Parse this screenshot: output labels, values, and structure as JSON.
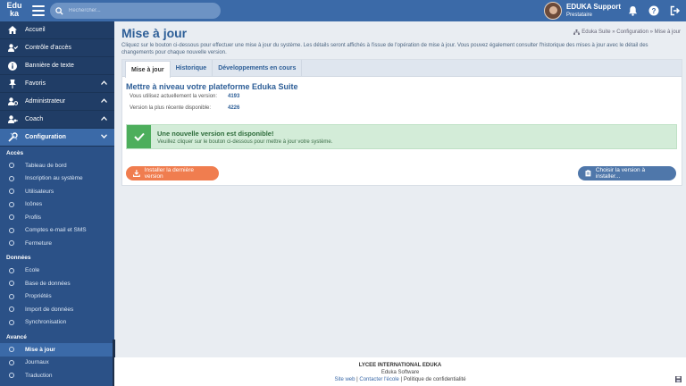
{
  "app": {
    "logo_top": "Edu",
    "logo_bottom": "ka"
  },
  "search": {
    "placeholder": "Rechercher..."
  },
  "user": {
    "name": "EDUKA Support",
    "role": "Prestataire"
  },
  "sidebar": {
    "items": [
      {
        "label": "Accueil",
        "icon": "home-icon"
      },
      {
        "label": "Contrôle d'accès",
        "icon": "user-check-icon"
      },
      {
        "label": "Bannière de texte",
        "icon": "info-icon"
      },
      {
        "label": "Favoris",
        "icon": "pin-icon"
      },
      {
        "label": "Administrateur",
        "icon": "user-gear-icon"
      },
      {
        "label": "Coach",
        "icon": "user-key-icon"
      },
      {
        "label": "Configuration",
        "icon": "tools-icon"
      }
    ],
    "sections": {
      "acces": {
        "title": "Accès",
        "items": [
          "Tableau de bord",
          "Inscription au système",
          "Utilisateurs",
          "Icônes",
          "Profils",
          "Comptes e-mail et SMS",
          "Fermeture"
        ]
      },
      "donnees": {
        "title": "Données",
        "items": [
          "Ecole",
          "Base de données",
          "Propriétés",
          "Import de données",
          "Synchronisation"
        ]
      },
      "avance": {
        "title": "Avancé",
        "items": [
          "Mise à jour",
          "Journaux",
          "Traduction"
        ]
      }
    }
  },
  "page": {
    "title": "Mise à jour",
    "breadcrumb": "Eduka Suite » Configuration » Mise à jour",
    "intro": "Cliquez sur le bouton ci-dessous pour effectuer une mise à jour du système. Les détails seront affichés à l'issue de l'opération de mise à jour. Vous pouvez également consulter l'historique des mises à jour avec le détail des changements pour chaque nouvelle version."
  },
  "tabs": [
    "Mise à jour",
    "Historique",
    "Développements en cours"
  ],
  "upgrade": {
    "title": "Mettre à niveau votre plateforme Eduka Suite",
    "current_label": "Vous utilisez actuellement la version:",
    "current_value": "4193",
    "latest_label": "Version la plus récente disponible:",
    "latest_value": "4226"
  },
  "alert": {
    "title": "Une nouvelle version est disponible!",
    "text": "Veuillez cliquer sur le bouton ci-dessous pour mettre à jour votre système."
  },
  "buttons": {
    "install": "Installer la dernière version",
    "choose": "Choisir la version à installer..."
  },
  "footer": {
    "school": "LYCEE INTERNATIONAL EDUKA",
    "company": "Eduka Software",
    "link_web": "Site web",
    "link_contact": "Contacter l'école",
    "link_privacy": "Politique de confidentialité",
    "sep": " | "
  },
  "colors": {
    "primary": "#3b6aa8",
    "sidebar": "#203d66",
    "accent": "#f07d4f",
    "success": "#4dae5c"
  }
}
